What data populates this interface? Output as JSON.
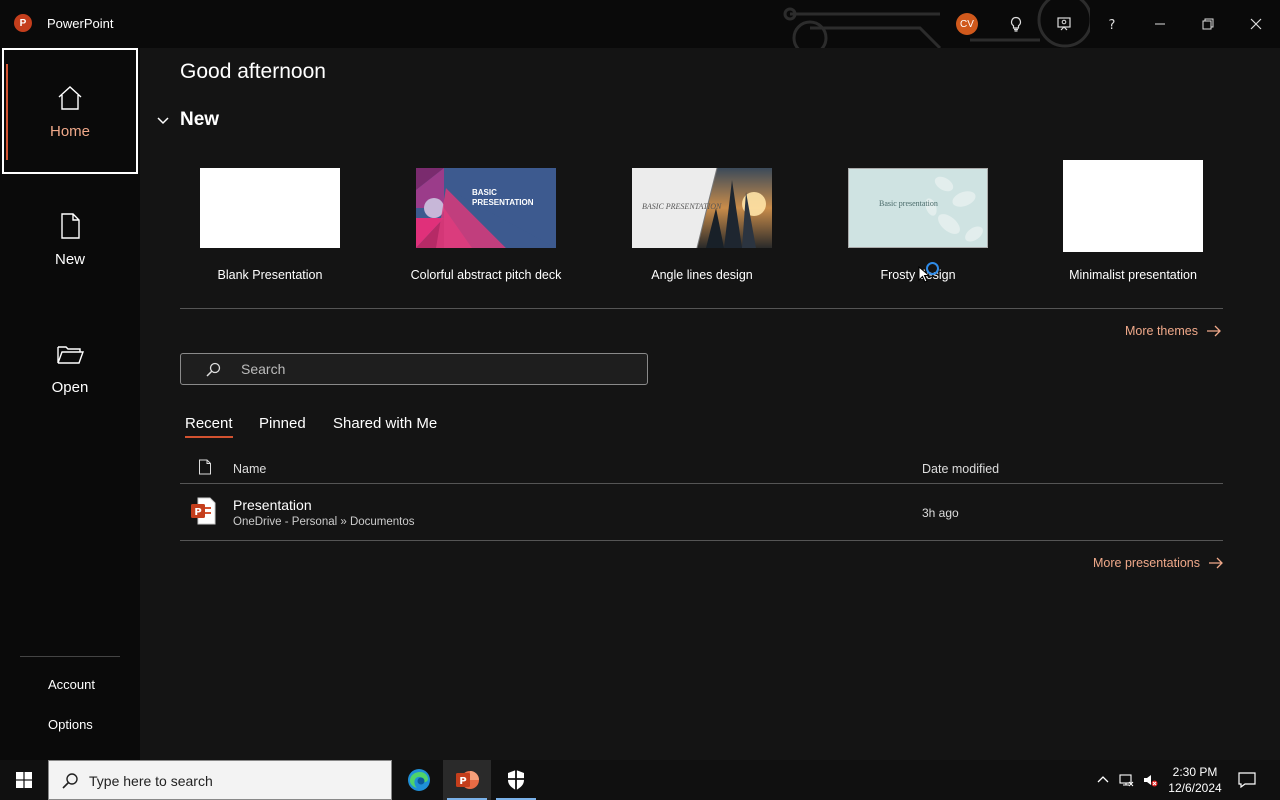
{
  "app": {
    "name": "PowerPoint",
    "logo_letter": "P",
    "user_initials": "CV"
  },
  "sidebar": {
    "items": [
      {
        "label": "Home",
        "icon": "home-icon"
      },
      {
        "label": "New",
        "icon": "new-document-icon"
      },
      {
        "label": "Open",
        "icon": "folder-open-icon"
      }
    ],
    "account": "Account",
    "options": "Options"
  },
  "main": {
    "greeting": "Good afternoon",
    "new_heading": "New",
    "templates": [
      {
        "name": "Blank Presentation"
      },
      {
        "name": "Colorful abstract pitch deck",
        "thumb_text": "BASIC PRESENTATION"
      },
      {
        "name": "Angle lines design",
        "thumb_text": "BASIC PRESENTATION"
      },
      {
        "name": "Frosty design",
        "thumb_text": "Basic presentation"
      },
      {
        "name": "Minimalist presentation"
      }
    ],
    "more_themes": "More themes",
    "search_placeholder": "Search",
    "tabs": [
      "Recent",
      "Pinned",
      "Shared with Me"
    ],
    "active_tab": "Recent",
    "columns": {
      "name": "Name",
      "date": "Date modified"
    },
    "files": [
      {
        "name": "Presentation",
        "location": "OneDrive - Personal » Documentos",
        "modified": "3h ago"
      }
    ],
    "more_presentations": "More presentations"
  },
  "taskbar": {
    "search_placeholder": "Type here to search",
    "time": "2:30 PM",
    "date": "12/6/2024"
  },
  "colors": {
    "accent": "#d35230",
    "accent_text": "#f0a98a",
    "background": "#141414"
  }
}
